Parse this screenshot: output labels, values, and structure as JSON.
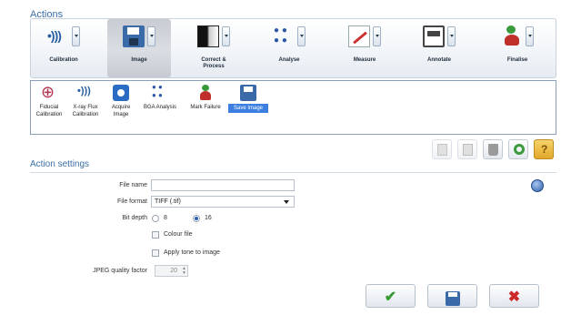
{
  "header": {
    "title": "Actions"
  },
  "toolbar": {
    "items": [
      {
        "label": "Calibration",
        "icon": "calibration-icon"
      },
      {
        "label": "Image",
        "icon": "image-icon"
      },
      {
        "label": "Correct & Process",
        "icon": "correct-process-icon"
      },
      {
        "label": "Analyse",
        "icon": "analyse-icon"
      },
      {
        "label": "Measure",
        "icon": "measure-icon"
      },
      {
        "label": "Annotate",
        "icon": "annotate-icon"
      },
      {
        "label": "Finalise",
        "icon": "finalise-icon"
      }
    ],
    "active": "Image"
  },
  "subbar": {
    "items": [
      {
        "label_line1": "Fiducial",
        "label_line2": "Calibration",
        "icon": "fiducial-icon"
      },
      {
        "label_line1": "X-ray Flux",
        "label_line2": "Calibration",
        "icon": "xray-flux-icon"
      },
      {
        "label_line1": "Acquire",
        "label_line2": "Image",
        "icon": "camera-icon"
      },
      {
        "label_line1": "BGA Analysis",
        "label_line2": "",
        "icon": "bga-icon"
      },
      {
        "label_line1": "Mark Failure",
        "label_line2": "",
        "icon": "mark-failure-icon"
      },
      {
        "label_line1": "Save Image",
        "label_line2": "",
        "icon": "save-image-icon"
      }
    ],
    "selected": "Save Image"
  },
  "settings": {
    "title": "Action settings",
    "file_name_label": "File name",
    "file_name_value": "",
    "file_format_label": "File format",
    "file_format_value": "TIFF (.tif)",
    "bit_depth_label": "Bit depth",
    "bit_depth_opt1": "8",
    "bit_depth_opt2": "16",
    "bit_depth_selected": "16",
    "colour_file_label": "Colour file",
    "colour_file_checked": false,
    "apply_tone_label": "Apply tone to image",
    "apply_tone_checked": false,
    "jpeg_quality_label": "JPEG quality factor",
    "jpeg_quality_value": "20"
  },
  "toolbar_buttons": [
    "copy-icon",
    "paste-icon",
    "delete-icon",
    "reset-icon",
    "help-icon"
  ],
  "help_glyph": "?",
  "footer": {
    "ok_glyph": "✔",
    "cancel_glyph": "✖",
    "save_icon": "save-icon"
  },
  "colors": {
    "accent": "#3a6fa8",
    "selected": "#3d7fe0",
    "ok": "#3a9b35",
    "cancel": "#cc2a2a"
  }
}
